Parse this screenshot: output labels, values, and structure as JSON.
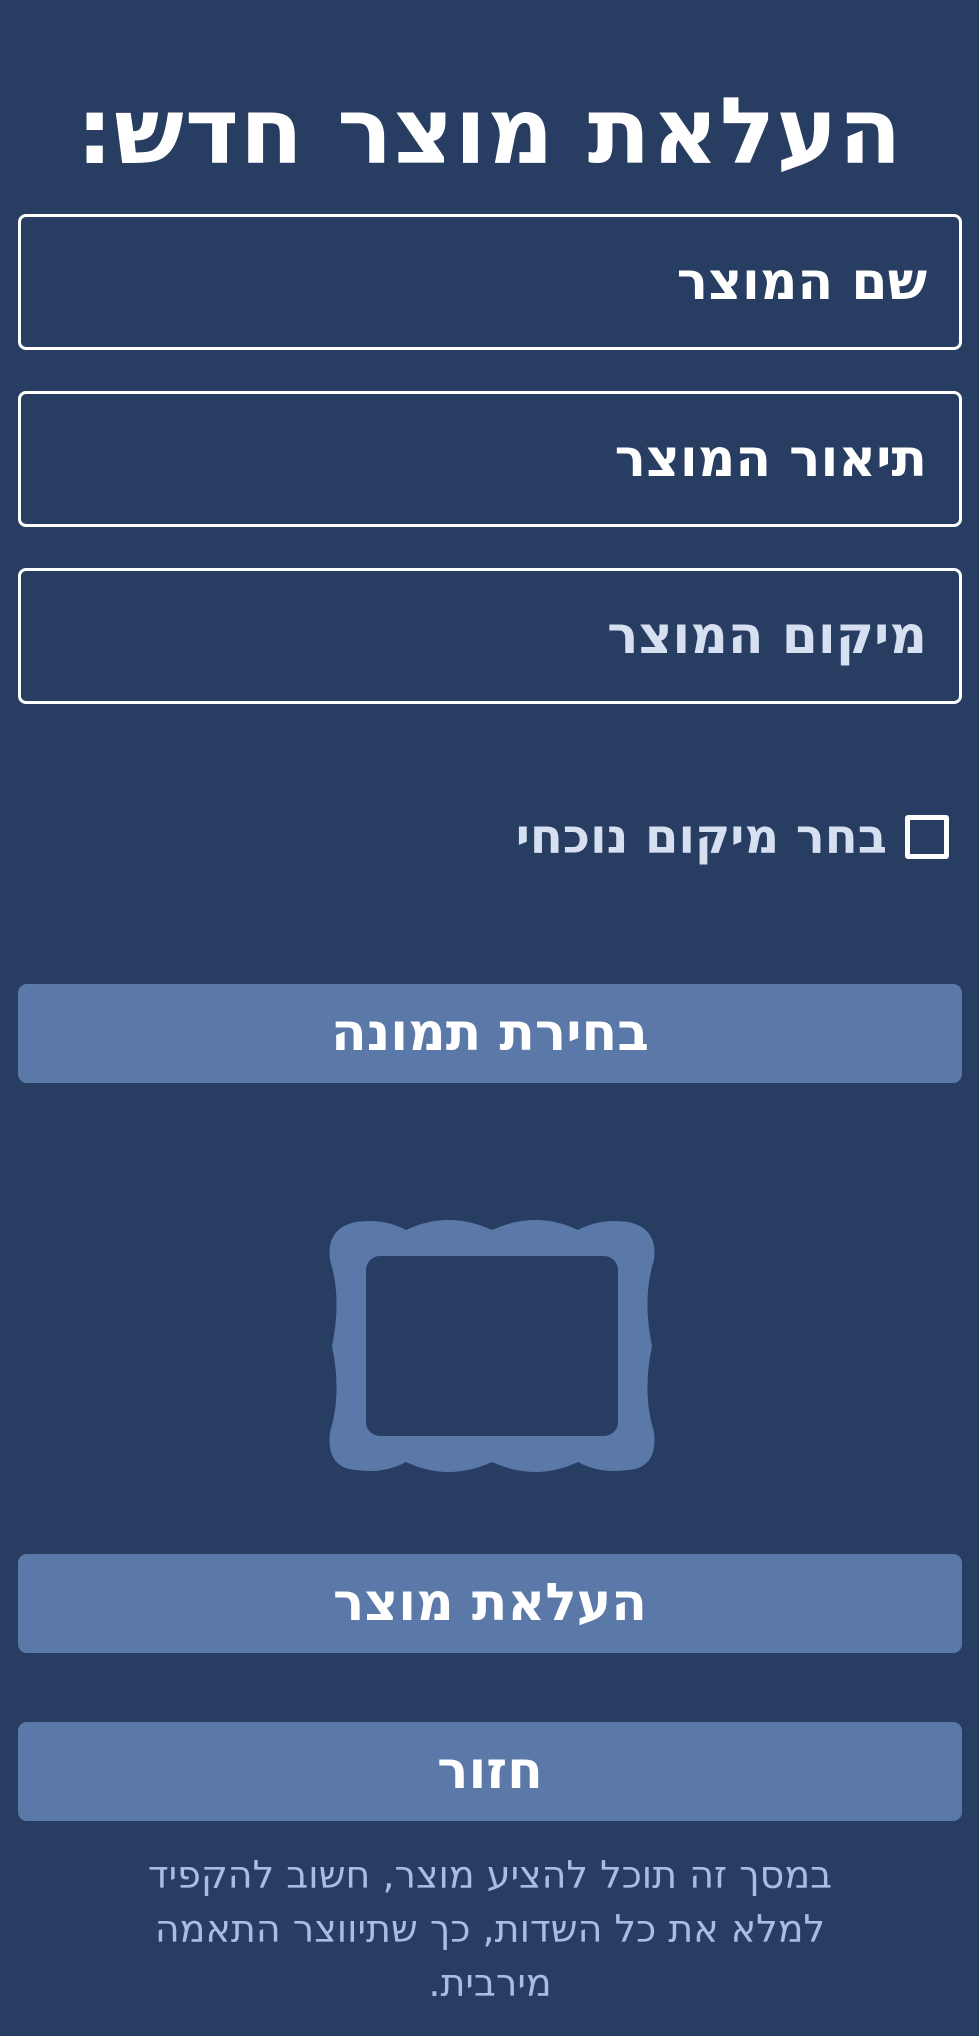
{
  "page": {
    "title": "העלאת מוצר חדש:"
  },
  "form": {
    "name_placeholder": "שם המוצר",
    "description_placeholder": "תיאור המוצר",
    "location_placeholder": "מיקום המוצר",
    "current_location_label": "בחר מיקום נוכחי",
    "current_location_checked": false
  },
  "buttons": {
    "pick_image": "בחירת תמונה",
    "upload": "העלאת מוצר",
    "back": "חזור"
  },
  "image_preview": {
    "icon": "image-frame-icon"
  },
  "footer": {
    "note": "במסך זה תוכל להציע מוצר, חשוב להקפיד למלא את כל השדות, כך שתיווצר התאמה מירבית."
  },
  "colors": {
    "background": "#283d62",
    "button": "#5a78a8",
    "note_text": "#a8bde0"
  }
}
